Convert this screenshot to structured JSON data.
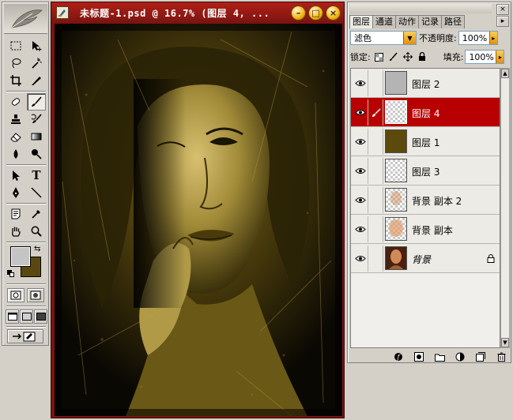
{
  "document": {
    "title": "未标题-1.psd @ 16.7% (图层 4, ...",
    "minimize_label": "–",
    "maximize_label": "□",
    "close_label": "×",
    "foreground_color": "#c4c4c4",
    "background_color": "#5a4810",
    "accent_color": "#7a1410"
  },
  "tools": {
    "type_label": "T"
  },
  "layers_panel": {
    "tabs": [
      {
        "label": "图层",
        "active": true
      },
      {
        "label": "通道",
        "active": false
      },
      {
        "label": "动作",
        "active": false
      },
      {
        "label": "记录",
        "active": false
      },
      {
        "label": "路径",
        "active": false
      }
    ],
    "blend_mode": "滤色",
    "opacity_label": "不透明度:",
    "opacity_value": "100%",
    "lock_label": "锁定:",
    "fill_label": "填充:",
    "fill_value": "100%",
    "close_label": "×",
    "selected_color": "#b80000",
    "layers": [
      {
        "name": "图层 2",
        "visible": true,
        "selected": false,
        "thumb": "gray"
      },
      {
        "name": "图层 4",
        "visible": true,
        "selected": true,
        "thumb": "checker"
      },
      {
        "name": "图层 1",
        "visible": true,
        "selected": false,
        "thumb": "olive"
      },
      {
        "name": "图层 3",
        "visible": true,
        "selected": false,
        "thumb": "checker"
      },
      {
        "name": "背景 副本 2",
        "visible": true,
        "selected": false,
        "thumb": "checker-face"
      },
      {
        "name": "背景 副本",
        "visible": true,
        "selected": false,
        "thumb": "face-light"
      },
      {
        "name": "背景",
        "visible": true,
        "selected": false,
        "thumb": "face",
        "locked": true
      }
    ]
  }
}
